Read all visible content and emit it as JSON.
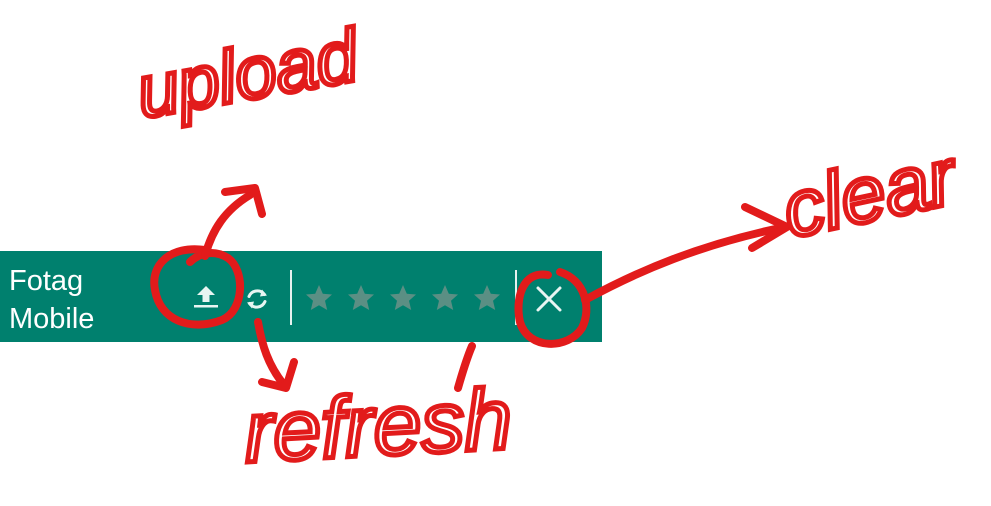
{
  "toolbar": {
    "title_line1": "Fotag",
    "title_line2": "Mobile",
    "background_color": "#00806e",
    "icon_color": "#e8f5f2",
    "buttons": [
      {
        "id": "upload",
        "icon": "upload-icon"
      },
      {
        "id": "refresh",
        "icon": "refresh-icon"
      },
      {
        "id": "clear",
        "icon": "close-icon"
      }
    ]
  },
  "rating": {
    "max_stars": 5,
    "value": 0,
    "star_color": "#5b8f84"
  },
  "annotations": {
    "color": "#e21b1b",
    "upload_label": "upload",
    "refresh_label": "refresh",
    "clear_label": "clear"
  }
}
